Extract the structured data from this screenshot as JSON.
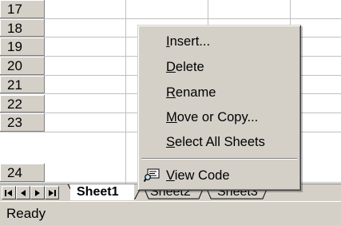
{
  "grid": {
    "rows": [
      "17",
      "18",
      "19",
      "20",
      "21",
      "22",
      "23",
      "24"
    ]
  },
  "sheet_tabs": {
    "nav_buttons": [
      "first-sheet",
      "previous-sheet",
      "next-sheet",
      "last-sheet"
    ],
    "tabs": [
      {
        "label": "Sheet1",
        "active": true
      },
      {
        "label": "Sheet2",
        "active": false
      },
      {
        "label": "Sheet3",
        "active": false
      }
    ]
  },
  "context_menu": {
    "items": [
      {
        "label": "Insert...",
        "accel": "I"
      },
      {
        "label": "Delete",
        "accel": "D"
      },
      {
        "label": "Rename",
        "accel": "R"
      },
      {
        "label": "Move or Copy...",
        "accel": "M"
      },
      {
        "label": "Select All Sheets",
        "accel": "S"
      },
      {
        "label": "View Code",
        "accel": "V",
        "icon": "view-code-icon"
      }
    ]
  },
  "status_bar": {
    "text": "Ready"
  },
  "colors": {
    "face": "#d4d0c8",
    "gridline": "#c0c0c0",
    "shadow": "#808080",
    "highlight": "#ffffff"
  }
}
